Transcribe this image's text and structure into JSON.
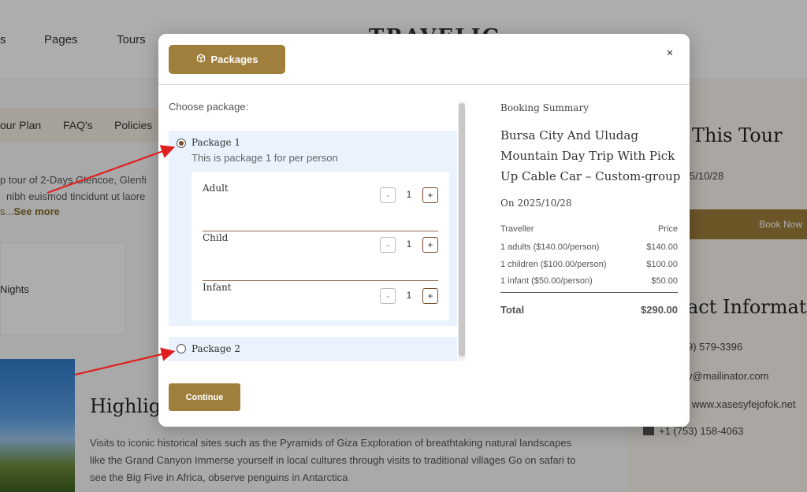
{
  "background": {
    "nav_items": [
      "s",
      "Pages",
      "Tours"
    ],
    "logo": "TRAVELIG",
    "subnav_items": [
      "our Plan",
      "FAQ's",
      "Policies"
    ],
    "description_lines": [
      "p tour of 2-Days Glencoe, Glenfi",
      "nibh euismod tincidunt ut laore",
      "s..."
    ],
    "see_more": "See more",
    "nights": "Nights",
    "highlight_title": "Highligh",
    "paragraph": "Visits to iconic historical sites such as the Pyramids of Giza Exploration of breathtaking natural landscapes like the Grand Canyon Immerse yourself in local cultures through visits to traditional villages Go on safari to see the Big Five in Africa, observe penguins in Antarctica",
    "right_title": "This Tour",
    "right_date": "5/10/28",
    "book_now": "Book Now",
    "contact_title": "act Informatio",
    "phone": "9) 579-3396",
    "email": "y@mailinator.com",
    "website": "www.xasesyfejofok.net",
    "fax": "+1 (753) 158-4063"
  },
  "modal": {
    "tab_label": "Packages",
    "tab_icon": "cube-icon",
    "close_label": "×",
    "choose_label": "Choose package:",
    "packages": [
      {
        "title": "Package 1",
        "description": "This is package 1 for per person",
        "selected": true,
        "travellers": [
          {
            "label": "Adult",
            "value": "1"
          },
          {
            "label": "Child",
            "value": "1"
          },
          {
            "label": "Infant",
            "value": "1"
          }
        ]
      },
      {
        "title": "Package 2",
        "selected": false
      }
    ],
    "stepper_minus": "-",
    "stepper_plus": "+",
    "continue_label": "Continue"
  },
  "summary": {
    "label": "Booking Summary",
    "tour_name": "Bursa City And Uludag Mountain Day Trip With Pick Up Cable Car – Custom-group",
    "date": "On 2025/10/28",
    "col_traveller": "Traveller",
    "col_price": "Price",
    "rows": [
      {
        "traveller": "1 adults ($140.00/person)",
        "price": "$140.00"
      },
      {
        "traveller": "1 children ($100.00/person)",
        "price": "$100.00"
      },
      {
        "traveller": "1 infant ($50.00/person)",
        "price": "$50.00"
      }
    ],
    "total_label": "Total",
    "total_value": "$290.00"
  },
  "colors": {
    "accent": "#a07f3c",
    "package_bg": "#e9f2fd",
    "annotation_arrow": "#e02020"
  }
}
